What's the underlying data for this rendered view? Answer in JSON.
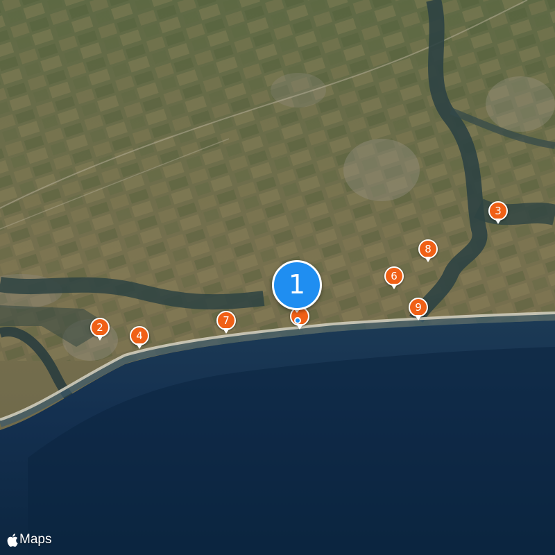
{
  "map": {
    "style": "satellite",
    "colors": {
      "pin": "#f06016",
      "pin_border": "#ffffff",
      "cluster": "#1f8ef1",
      "sea": "#0f2a44",
      "land": "#6b6a4a",
      "water_channel": "#2a3d3e"
    }
  },
  "markers": [
    {
      "label": "1",
      "kind": "selected-cluster"
    },
    {
      "label": "2",
      "kind": "pin"
    },
    {
      "label": "3",
      "kind": "pin"
    },
    {
      "label": "4",
      "kind": "pin"
    },
    {
      "label": "6",
      "kind": "pin"
    },
    {
      "label": "7",
      "kind": "pin"
    },
    {
      "label": "8",
      "kind": "pin"
    },
    {
      "label": "9",
      "kind": "pin"
    }
  ],
  "brand": {
    "icon": "apple-logo-icon",
    "text": "Maps"
  }
}
